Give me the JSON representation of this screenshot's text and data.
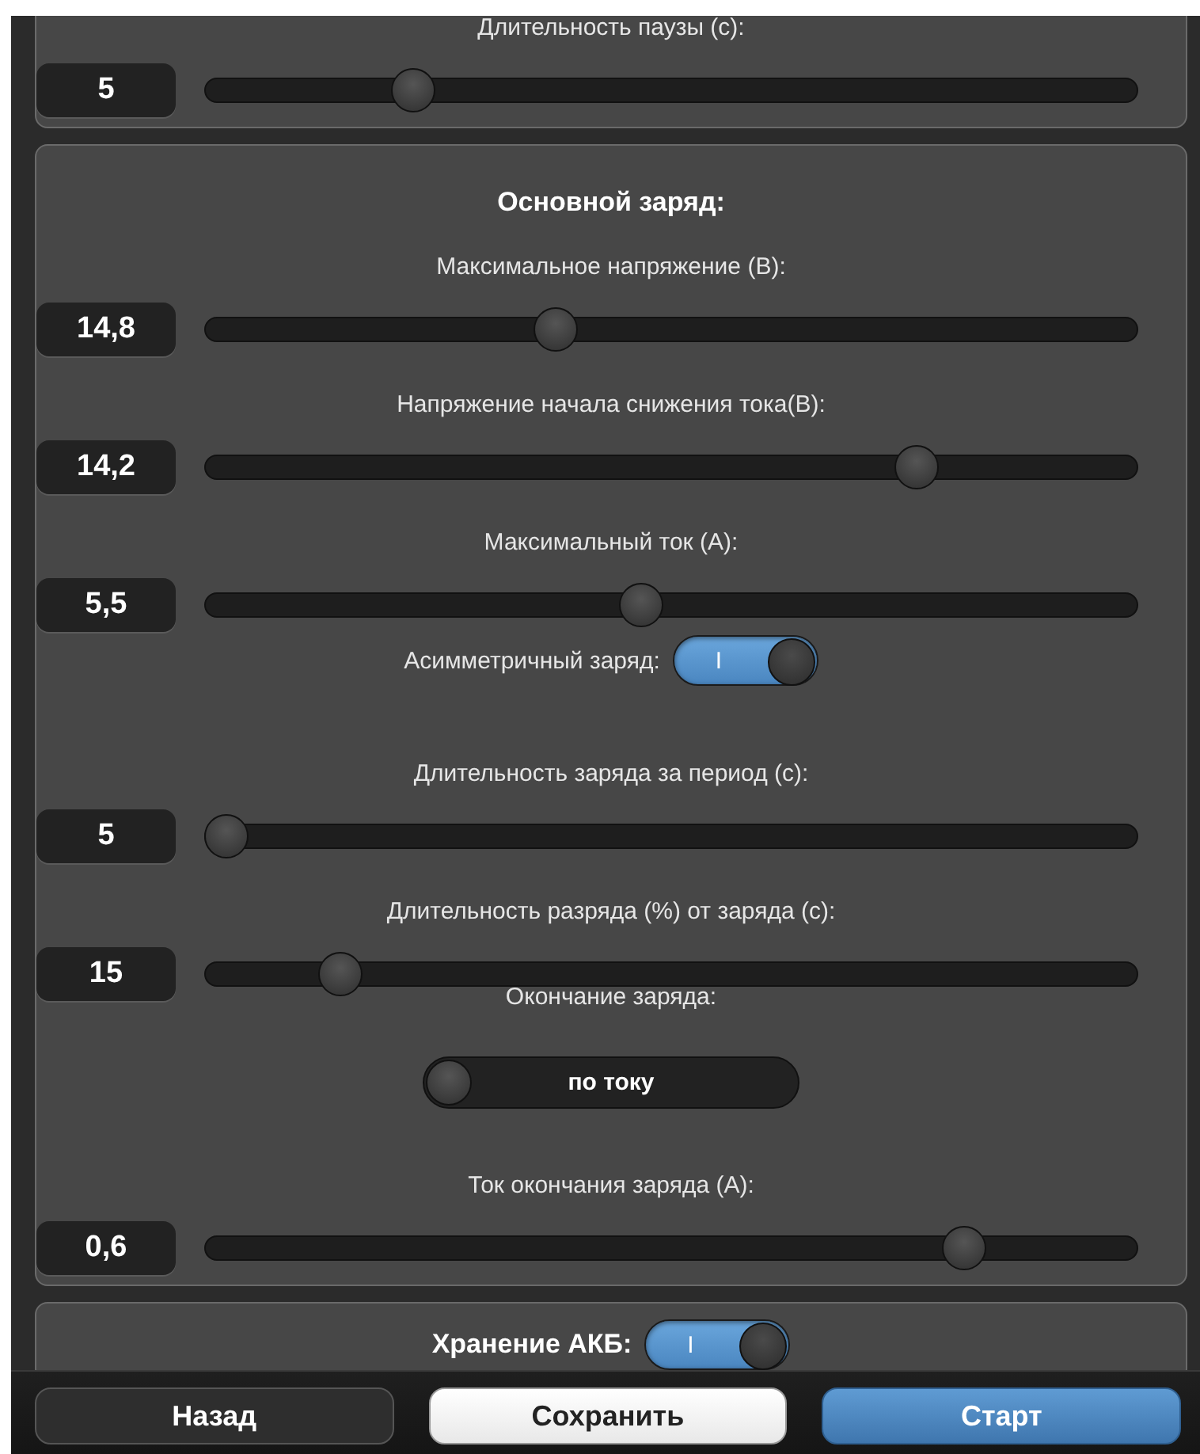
{
  "panels": [
    {
      "items": [
        {
          "kind": "slider",
          "label": "Длительность паузы (с):",
          "value": "5",
          "level": 0.21
        }
      ]
    },
    {
      "title": "Основной заряд:",
      "items": [
        {
          "kind": "slider",
          "label": "Максимальное напряжение (В):",
          "value": "14,8",
          "level": 0.37
        },
        {
          "kind": "slider",
          "label": "Напряжение начала снижения тока(В):",
          "value": "14,2",
          "level": 0.775
        },
        {
          "kind": "slider",
          "label": "Максимальный ток (А):",
          "value": "5,5",
          "level": 0.466
        },
        {
          "kind": "toggle",
          "label": "Асимметричный заряд:",
          "on": true,
          "mark": "I"
        },
        {
          "kind": "slider",
          "label": "Длительность заряда за период (с):",
          "value": "5",
          "level": 0.0
        },
        {
          "kind": "slider",
          "label": "Длительность разряда (%) от заряда (с):",
          "value": "15",
          "level": 0.128
        },
        {
          "kind": "choice",
          "label": "Окончание заряда:",
          "value": "по току",
          "on": false
        },
        {
          "kind": "slider",
          "label": "Ток окончания заряда (А):",
          "value": "0,6",
          "level": 0.83
        }
      ]
    },
    {
      "title": "Хранение АКБ:",
      "title_toggle": {
        "on": true,
        "mark": "I"
      }
    }
  ],
  "footer": [
    {
      "kind": "dark",
      "label": "Назад"
    },
    {
      "kind": "light",
      "label": "Сохранить"
    },
    {
      "kind": "primary",
      "label": "Старт"
    }
  ]
}
